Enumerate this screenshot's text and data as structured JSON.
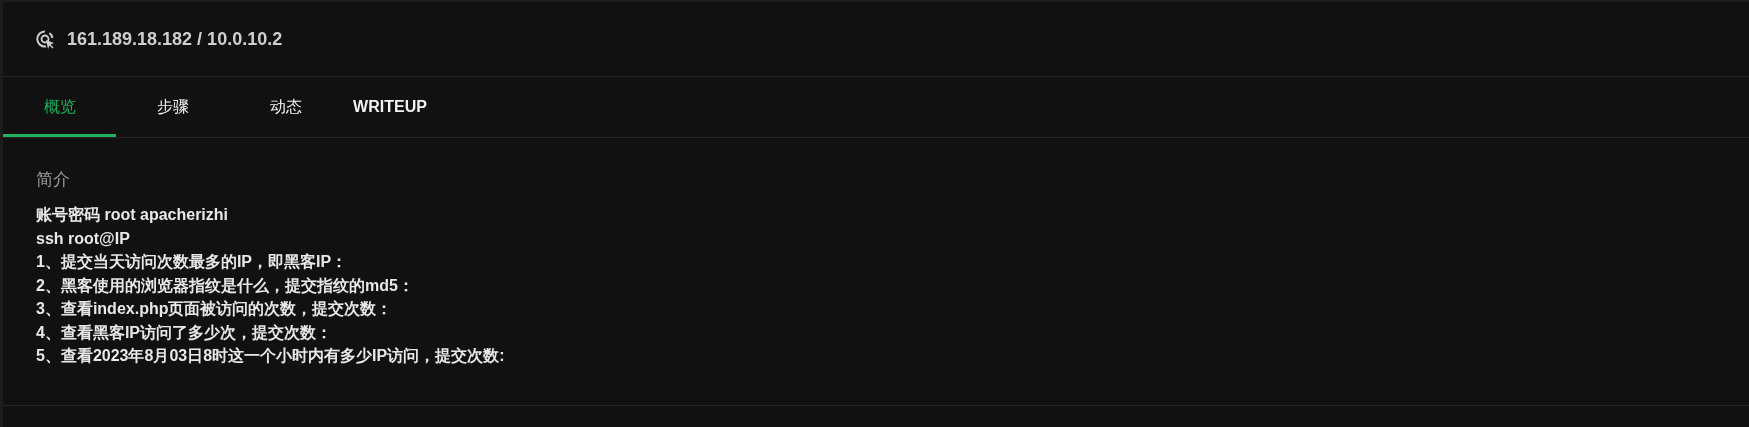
{
  "header": {
    "title": "161.189.18.182 / 10.0.10.2"
  },
  "tabs": [
    {
      "label": "概览",
      "selected": true
    },
    {
      "label": "步骤",
      "selected": false
    },
    {
      "label": "动态",
      "selected": false
    },
    {
      "label": "WRITEUP",
      "selected": false
    }
  ],
  "intro": {
    "heading": "简介",
    "lines": [
      "账号密码 root apacherizhi",
      "ssh root@IP",
      "1、提交当天访问次数最多的IP，即黑客IP：",
      "2、黑客使用的浏览器指纹是什么，提交指纹的md5：",
      "3、查看index.php页面被访问的次数，提交次数：",
      "4、查看黑客IP访问了多少次，提交次数：",
      "5、查看2023年8月03日8时这一个小时内有多少IP访问，提交次数:"
    ]
  }
}
